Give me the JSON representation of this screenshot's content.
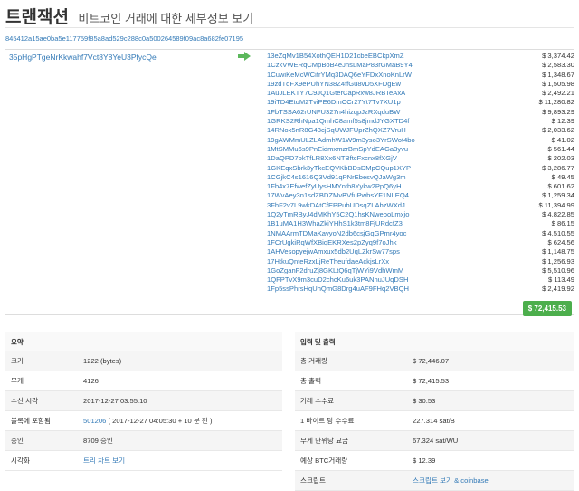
{
  "header": {
    "title": "트랜잭션",
    "subtitle": "비트코인 거래에 대한 세부정보 보기"
  },
  "txid": "845412a15ae0ba5e117759f85a8ad529c288c0a500264589f09ac8a682fe07195",
  "inputs": [
    {
      "address": "35pHgPTgeNrKkwahf7Vct8Y8YeU3PfycQe"
    }
  ],
  "outputs": [
    {
      "address": "13eZqMv1B54XothQEH1D21cbeEBCkpXmZ",
      "amount": "$ 3,374.42"
    },
    {
      "address": "1CzkVWERqCMpBoB4eJnsLMaP83rGMaB9Y4",
      "amount": "$ 2,583.30"
    },
    {
      "address": "1CuwiKeMcWCifrYMq3DAQ6eYFDxXnoKnLrW",
      "amount": "$ 1,348.67"
    },
    {
      "address": "19zdTqFX9ePUhYN38Z4ffGu8vD5XFDgEw",
      "amount": "$ 1,505.98"
    },
    {
      "address": "1AuJLEKTY7C9JQ1GterCapRxw8JRBTeAxA",
      "amount": "$ 2,492.21"
    },
    {
      "address": "19iTD4EtoM2TviPE6DmCCr27Yt7Tv7XU1p",
      "amount": "$ 11,280.82"
    },
    {
      "address": "1FbTSSA62rUNFU327n4hizqpJzRXqduBW",
      "amount": "$ 9,893.29"
    },
    {
      "address": "1GRKS2RhNpa1QmhC8amf5s8jmdJYGXTD4f",
      "amount": "$ 12.39"
    },
    {
      "address": "14RNox5nR8G43cjSqUWJFUprZhQXZ7VruH",
      "amount": "$ 2,033.62"
    },
    {
      "address": "19gAWMmULZLAdmhW1W9m3yso3YrSWot4bo",
      "amount": "$ 41.02"
    },
    {
      "address": "1MtSMMu6s9PnEidmxmzrBmSpYdEAGa3yvu",
      "amount": "$ 561.44"
    },
    {
      "address": "1DaQPD7okTfLR8Xx6NTBftcFxcnx8fXGjV",
      "amount": "$ 202.03"
    },
    {
      "address": "1GKEqxSbrk3yTkcEQVKbBDsDMpCQup1XYP",
      "amount": "$ 3,286.77"
    },
    {
      "address": "1CGjkC4s1616Q3Vd91qPNrEbesvQJaWg3m",
      "amount": "$ 49.45"
    },
    {
      "address": "1Fb4x7EfwefZyUysHMYntb8Yykw2PpQ6yH",
      "amount": "$ 601.62"
    },
    {
      "address": "17WvAey3n1sdZBDZMvBVfuPwbsYF1NLEQ4",
      "amount": "$ 1,259.34"
    },
    {
      "address": "3FhF2v7L9wkDAtCfEPPubUDsqZLAbzWXdJ",
      "amount": "$ 11,394.99"
    },
    {
      "address": "1Q2yTmRByJ4dMKhY5C2Q1hsKNweooLmxjo",
      "amount": "$ 4,822.85"
    },
    {
      "address": "1B1uMA1H3WhaZkiYHhS1k3tm8FjURdcfZ3",
      "amount": "$ 86.15"
    },
    {
      "address": "1NMAArmTDMaKavyoN2db6csjGqGPmr4yoc",
      "amount": "$ 4,510.55"
    },
    {
      "address": "1FCrUgkiRqWfXBiqEKRXes2pZyq9f7oJhk",
      "amount": "$ 624.56"
    },
    {
      "address": "1AHVesopyejwAmxux5db2UqLZkrSw77sps",
      "amount": "$ 1,148.75"
    },
    {
      "address": "17HtkuQnteRzxLjReTheufdaeAckjsLrXx",
      "amount": "$ 1,256.93"
    },
    {
      "address": "1GoZganF2druZj8GKLtQ6qTjWYi9VdhWmM",
      "amount": "$ 5,510.96"
    },
    {
      "address": "1QFPTvX9m3cuD2chcKu6uk3PANnuJUqDSH",
      "amount": "$ 113.49"
    },
    {
      "address": "1Fp5ssPhrsHqUhQmG8Drg4uAF9FHq2VBQH",
      "amount": "$ 2,419.92"
    }
  ],
  "total_output": "$ 72,415.53",
  "summary": {
    "heading": "요약",
    "rows": [
      {
        "label": "크기",
        "value": "1222 (bytes)"
      },
      {
        "label": "무게",
        "value": "4126"
      },
      {
        "label": "수신 시각",
        "value": "2017-12-27 03:55:10"
      },
      {
        "label": "블록에 포함됨",
        "value_link": "501206",
        "value_rest": " ( 2017-12-27 04:05:30 + 10 분 전 )"
      },
      {
        "label": "승인",
        "value": "8709 승인"
      },
      {
        "label": "시각화",
        "value_link": "트리 차트 보기"
      }
    ]
  },
  "io_panel": {
    "heading": "입력 및 출력",
    "rows": [
      {
        "label": "총 거래량",
        "value": "$ 72,446.07"
      },
      {
        "label": "총 출력",
        "value": "$ 72,415.53"
      },
      {
        "label": "거래 수수료",
        "value": "$ 30.53"
      },
      {
        "label": "1 바이트 당 수수료",
        "value": "227.314 sat/B"
      },
      {
        "label": "무게 단위당 요금",
        "value": "67.324 sat/WU"
      },
      {
        "label": "예상 BTC거래량",
        "value": "$ 12.39"
      },
      {
        "label": "스크립트",
        "value_link": "스크립트 보기 & coinbase"
      }
    ]
  },
  "colors": {
    "link": "#337ab7",
    "success": "#4cae4c",
    "arrow": "#5cb85c"
  }
}
